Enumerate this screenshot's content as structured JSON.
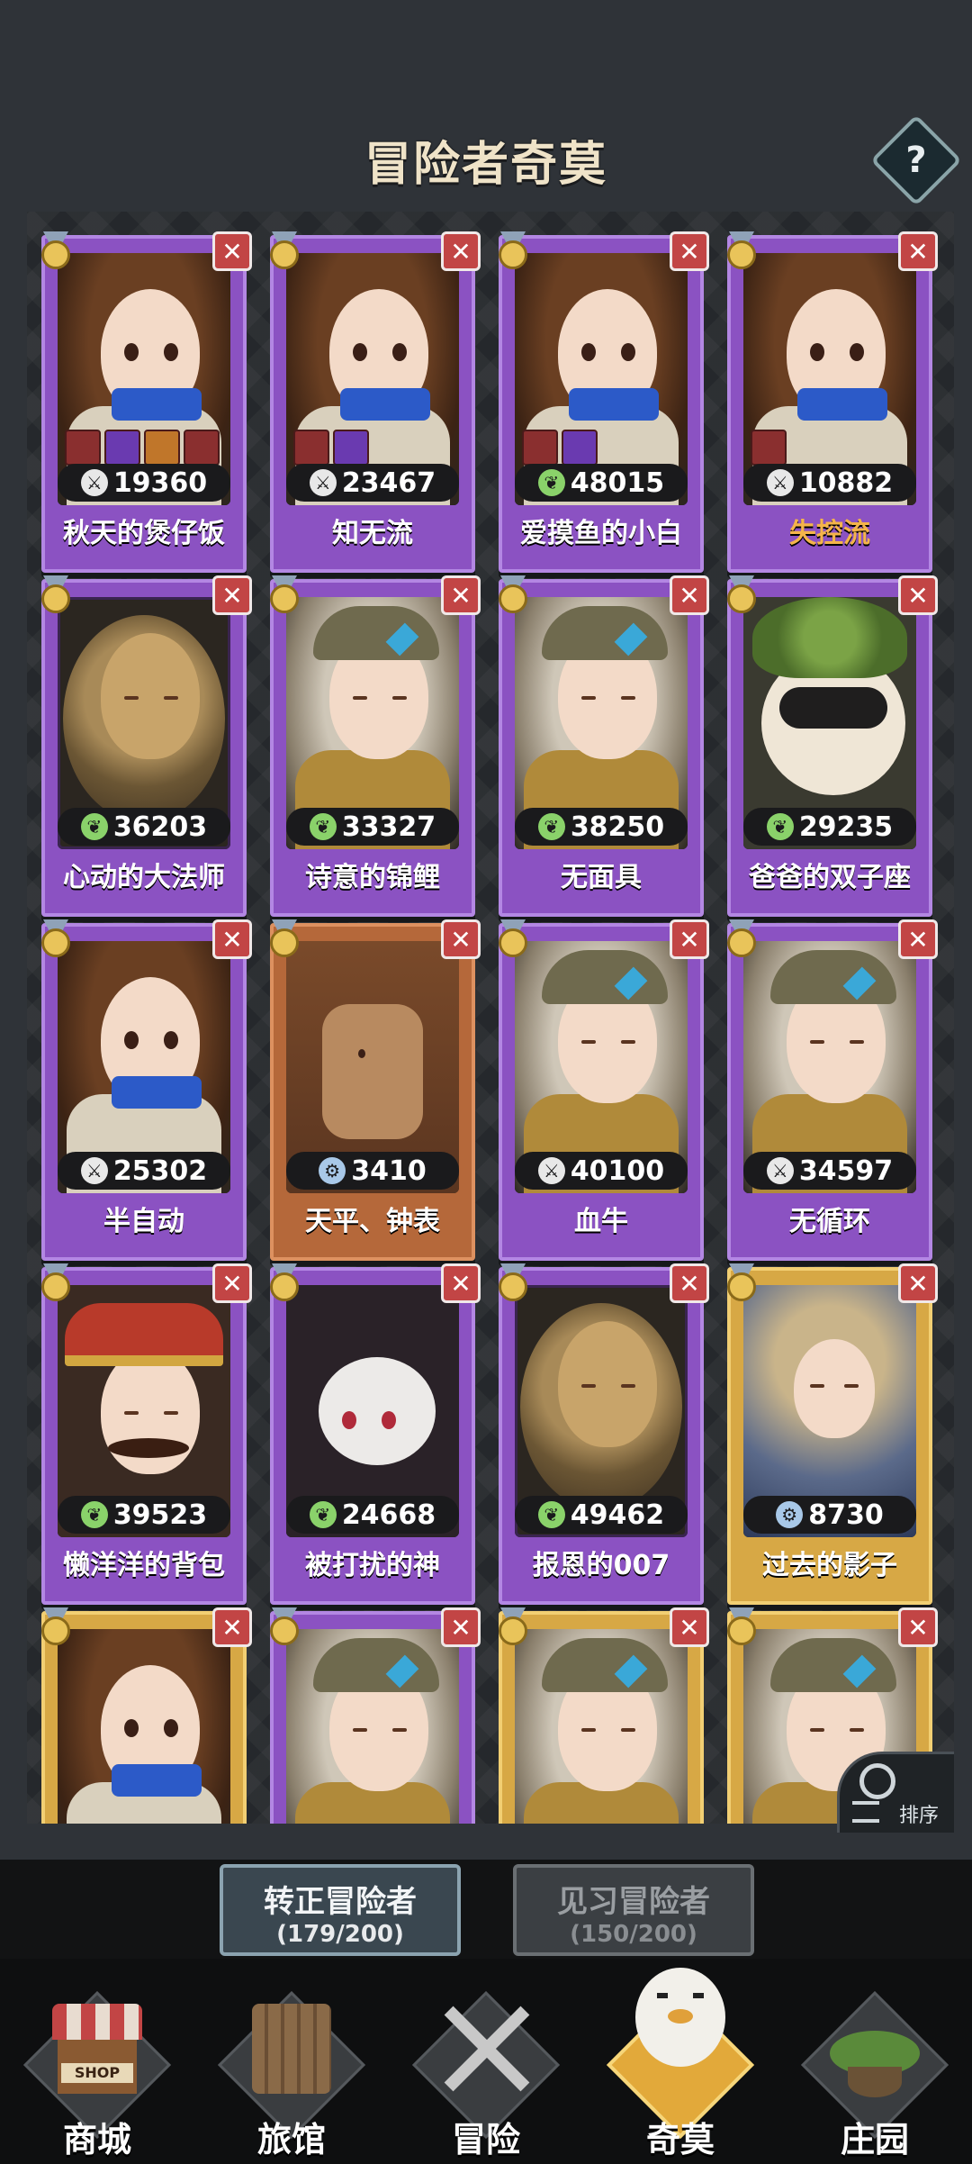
{
  "header": {
    "title": "冒险者奇莫",
    "help_label": "?"
  },
  "cards": [
    {
      "name": "秋天的煲仔饭",
      "power": "19360",
      "frame": "purple",
      "art": "girl",
      "skills": 4,
      "power_icon": "sword",
      "name_color": "white"
    },
    {
      "name": "知无流",
      "power": "23467",
      "frame": "purple",
      "art": "girl",
      "skills": 2,
      "power_icon": "sword",
      "name_color": "white"
    },
    {
      "name": "爱摸鱼的小白",
      "power": "48015",
      "frame": "purple",
      "art": "girl",
      "skills": 2,
      "power_icon": "leaf",
      "name_color": "white"
    },
    {
      "name": "失控流",
      "power": "10882",
      "frame": "purple",
      "art": "girl",
      "skills": 1,
      "power_icon": "sword",
      "name_color": "orange"
    },
    {
      "name": "心动的大法师",
      "power": "36203",
      "frame": "purple",
      "art": "lion",
      "skills": 0,
      "power_icon": "leaf",
      "name_color": "white"
    },
    {
      "name": "诗意的锦鲤",
      "power": "33327",
      "frame": "purple",
      "art": "elf",
      "skills": 0,
      "power_icon": "leaf",
      "name_color": "white"
    },
    {
      "name": "无面具",
      "power": "38250",
      "frame": "purple",
      "art": "elf",
      "skills": 0,
      "power_icon": "leaf",
      "name_color": "white"
    },
    {
      "name": "爸爸的双子座",
      "power": "29235",
      "frame": "purple",
      "art": "raccoon",
      "skills": 0,
      "power_icon": "leaf",
      "name_color": "white"
    },
    {
      "name": "半自动",
      "power": "25302",
      "frame": "purple",
      "art": "girl",
      "skills": 0,
      "power_icon": "sword",
      "name_color": "white"
    },
    {
      "name": "天平、钟表",
      "power": "3410",
      "frame": "orange",
      "art": "scarecrow",
      "skills": 0,
      "power_icon": "wrench",
      "name_color": "white"
    },
    {
      "name": "血牛",
      "power": "40100",
      "frame": "purple",
      "art": "elf",
      "skills": 0,
      "power_icon": "sword",
      "name_color": "white"
    },
    {
      "name": "无循环",
      "power": "34597",
      "frame": "purple",
      "art": "elf",
      "skills": 0,
      "power_icon": "sword",
      "name_color": "white"
    },
    {
      "name": "懒洋洋的背包",
      "power": "39523",
      "frame": "purple",
      "art": "king",
      "skills": 0,
      "power_icon": "leaf",
      "name_color": "white"
    },
    {
      "name": "被打扰的神",
      "power": "24668",
      "frame": "purple",
      "art": "ghost",
      "skills": 0,
      "power_icon": "leaf",
      "name_color": "white"
    },
    {
      "name": "报恩的007",
      "power": "49462",
      "frame": "purple",
      "art": "lion",
      "skills": 0,
      "power_icon": "leaf",
      "name_color": "white"
    },
    {
      "name": "过去的影子",
      "power": "8730",
      "frame": "gold",
      "art": "monk",
      "skills": 0,
      "power_icon": "wrench",
      "name_color": "white"
    },
    {
      "name": "",
      "power": "",
      "frame": "gold",
      "art": "girl",
      "skills": 0,
      "power_icon": "",
      "name_color": "white"
    },
    {
      "name": "",
      "power": "",
      "frame": "purple",
      "art": "elf",
      "skills": 0,
      "power_icon": "",
      "name_color": "white"
    },
    {
      "name": "",
      "power": "",
      "frame": "gold",
      "art": "elf",
      "skills": 0,
      "power_icon": "",
      "name_color": "white"
    },
    {
      "name": "",
      "power": "",
      "frame": "gold",
      "art": "elf",
      "skills": 0,
      "power_icon": "",
      "name_color": "white"
    }
  ],
  "sort": {
    "label": "排序"
  },
  "roster_tabs": [
    {
      "label": "转正冒险者",
      "count": "(179/200)",
      "active": true
    },
    {
      "label": "见习冒险者",
      "count": "(150/200)",
      "active": false
    }
  ],
  "bottom_nav": [
    {
      "label": "商城",
      "icon": "shop-icon",
      "sign": "SHOP",
      "active": false
    },
    {
      "label": "旅馆",
      "icon": "inn-gate-icon",
      "active": false
    },
    {
      "label": "冒险",
      "icon": "crossed-swords-icon",
      "active": false
    },
    {
      "label": "奇莫",
      "icon": "chicken-mascot-icon",
      "active": true
    },
    {
      "label": "庄园",
      "icon": "floating-island-icon",
      "active": false
    }
  ],
  "colors": {
    "background": "#2f3338",
    "card_purple": "#8b52c2",
    "card_orange": "#b5683a",
    "card_gold": "#d7a845",
    "remove_red": "#c24545",
    "nav_active": "#e2a93a"
  }
}
